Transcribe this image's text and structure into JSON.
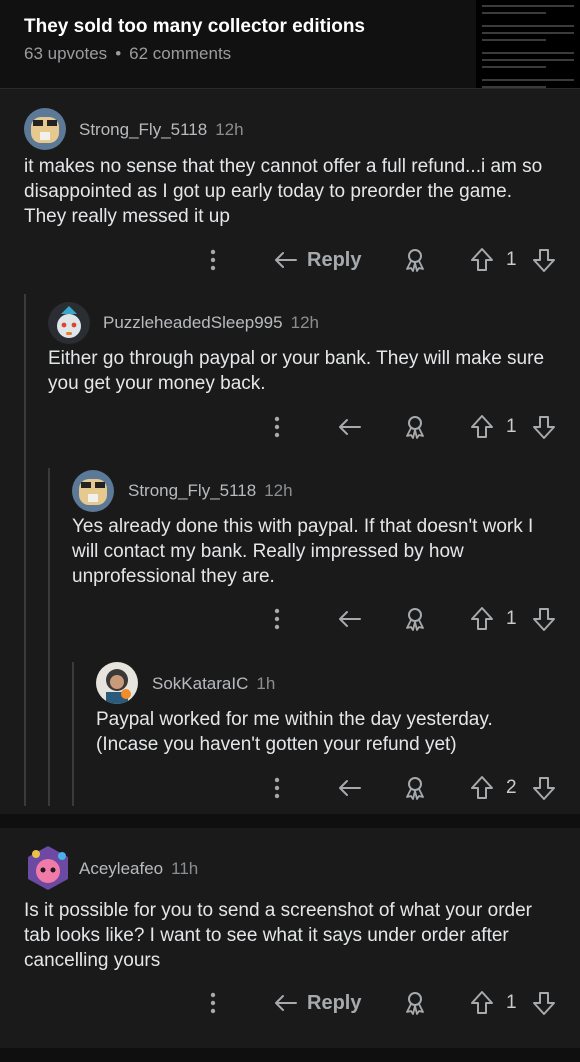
{
  "post": {
    "title": "They sold too many collector editions",
    "upvotes": "63 upvotes",
    "separator": "•",
    "comments": "62 comments"
  },
  "comments": [
    {
      "username": "Strong_Fly_5118",
      "time": "12h",
      "body": "it makes no sense that they cannot offer a full refund...i am so disappointed as I got up early today to preorder the game. They really messed it up",
      "reply_label": "Reply",
      "votes": "1"
    },
    {
      "username": "PuzzleheadedSleep995",
      "time": "12h",
      "body": "Either go through paypal or your bank. They will make sure you get your money back.",
      "votes": "1"
    },
    {
      "username": "Strong_Fly_5118",
      "time": "12h",
      "body": "Yes already done this with paypal. If that doesn't work I will contact my bank. Really impressed by how unprofessional they are.",
      "votes": "1"
    },
    {
      "username": "SokKataraIC",
      "time": "1h",
      "body": "Paypal worked for me within the day yesterday. (Incase you haven't gotten your refund yet)",
      "votes": "2"
    },
    {
      "username": "Aceyleafeo",
      "time": "11h",
      "body": "Is it possible for you to send a screenshot of what your order tab looks like? I want to see what it says under order after cancelling yours",
      "reply_label": "Reply",
      "votes": "1"
    }
  ],
  "icons": {
    "more": "more-vertical-icon",
    "reply": "reply-arrow-icon",
    "award": "award-icon",
    "upvote": "upvote-arrow-icon",
    "downvote": "downvote-arrow-icon"
  },
  "colors": {
    "background": "#1a1a1b",
    "header": "#111112",
    "text": "#e4e6e8",
    "muted": "#8b8e91"
  }
}
